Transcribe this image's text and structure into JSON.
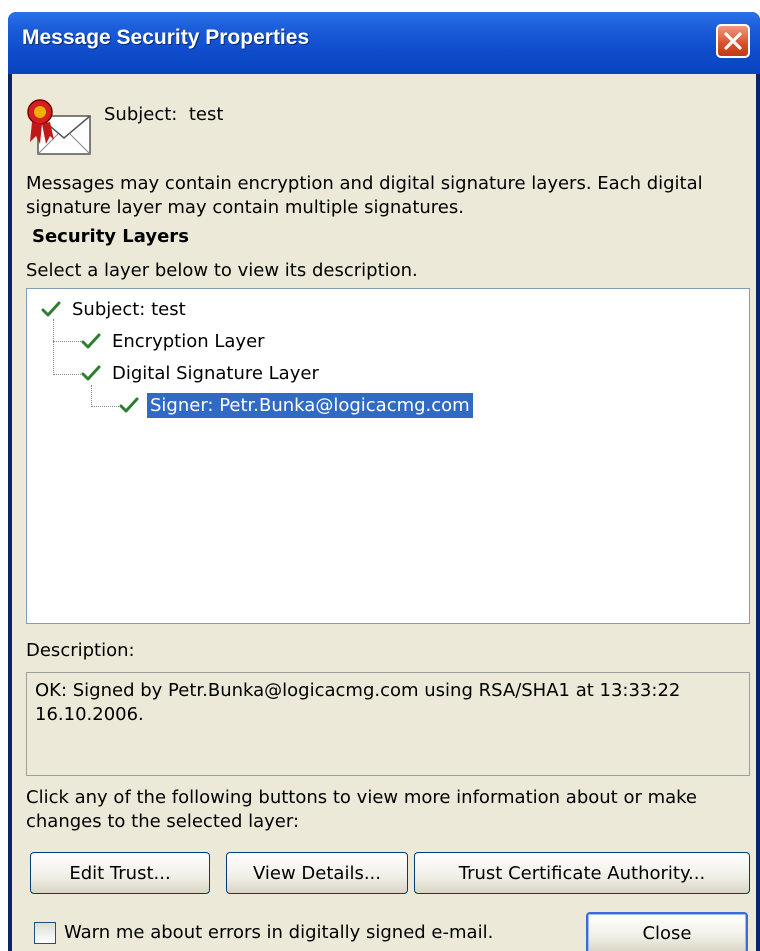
{
  "window": {
    "title": "Message Security Properties"
  },
  "subject": {
    "prefix": "Subject:",
    "value": "test"
  },
  "intro_text": "Messages may contain encryption and digital signature layers.  Each digital signature layer may contain multiple signatures.",
  "security_layers": {
    "heading": "Security Layers",
    "hint": "Select a layer below to view its description.",
    "nodes": [
      {
        "label": "Subject: test",
        "status": "check"
      },
      {
        "label": "Encryption Layer",
        "status": "check"
      },
      {
        "label": "Digital Signature Layer",
        "status": "check"
      },
      {
        "label": "Signer: Petr.Bunka@logicacmg.com",
        "status": "check",
        "selected": true
      }
    ]
  },
  "description": {
    "label": "Description:",
    "text": "OK: Signed by Petr.Bunka@logicacmg.com using RSA/SHA1 at 13:33:22 16.10.2006."
  },
  "actions": {
    "hint": "Click any of the following buttons to view more information about or make changes to the selected layer:",
    "edit_trust": "Edit Trust...",
    "view_details": "View Details...",
    "trust_ca": "Trust Certificate Authority..."
  },
  "footer": {
    "warn_label": "Warn me about errors in digitally signed e-mail.",
    "warn_checked": false,
    "close": "Close"
  },
  "colors": {
    "title_bar": "#0f4dcc",
    "dialog_bg": "#ece9d8",
    "selection": "#316ac5",
    "check": "#2e7d32"
  }
}
